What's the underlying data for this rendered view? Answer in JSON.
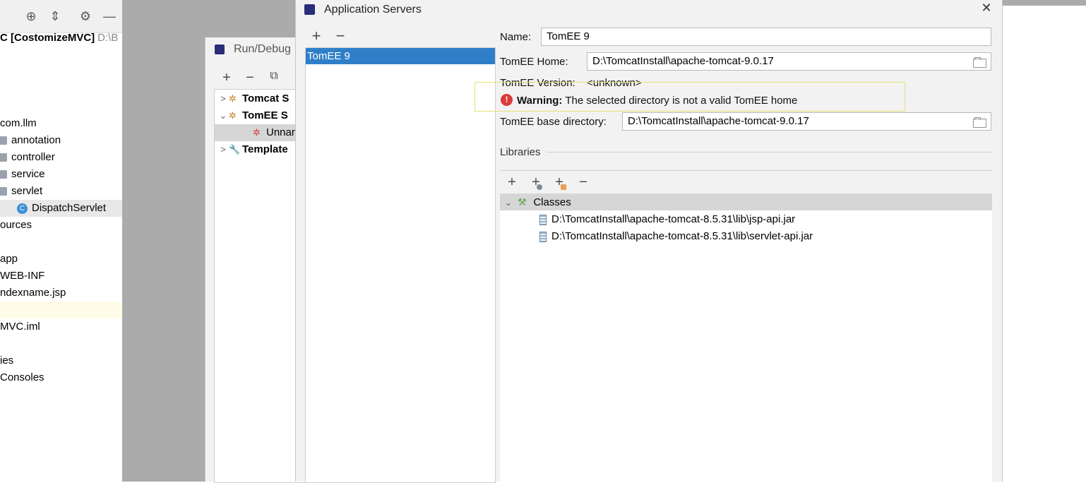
{
  "project": {
    "root_name": "C [CostomizeMVC]",
    "root_path": "D:\\B",
    "items": [
      "com.llm",
      "annotation",
      "controller",
      "service",
      "servlet",
      "DispatchServlet",
      "ources",
      "app",
      "WEB-INF",
      "ndexname.jsp",
      "MVC.iml",
      "ies",
      "Consoles"
    ]
  },
  "run_debug": {
    "title": "Run/Debug",
    "tree": [
      "Tomcat S",
      "TomEE S",
      "Unnam",
      "Template"
    ]
  },
  "app_servers": {
    "title": "Application Servers",
    "close": "✕",
    "add": "+",
    "remove": "−",
    "servers": [
      "TomEE 9"
    ],
    "name_label": "Name:",
    "name_value": "TomEE 9",
    "home_label": "TomEE Home:",
    "home_value": "D:\\TomcatInstall\\apache-tomcat-9.0.17",
    "version_label": "TomEE Version:",
    "version_value": "<unknown>",
    "warning_bold": "Warning:",
    "warning_text": "The selected directory is not a valid TomEE home",
    "base_label": "TomEE base directory:",
    "base_value": "D:\\TomcatInstall\\apache-tomcat-9.0.17",
    "libraries_label": "Libraries",
    "lib_buttons": [
      "+",
      "+",
      "+",
      "−"
    ],
    "classes_label": "Classes",
    "jars": [
      "D:\\TomcatInstall\\apache-tomcat-8.5.31\\lib\\jsp-api.jar",
      "D:\\TomcatInstall\\apache-tomcat-8.5.31\\lib\\servlet-api.jar"
    ]
  },
  "colors": {
    "selection": "#2f7fc8",
    "warning_icon": "#db3b3b",
    "warning_border": "#e4e373"
  }
}
